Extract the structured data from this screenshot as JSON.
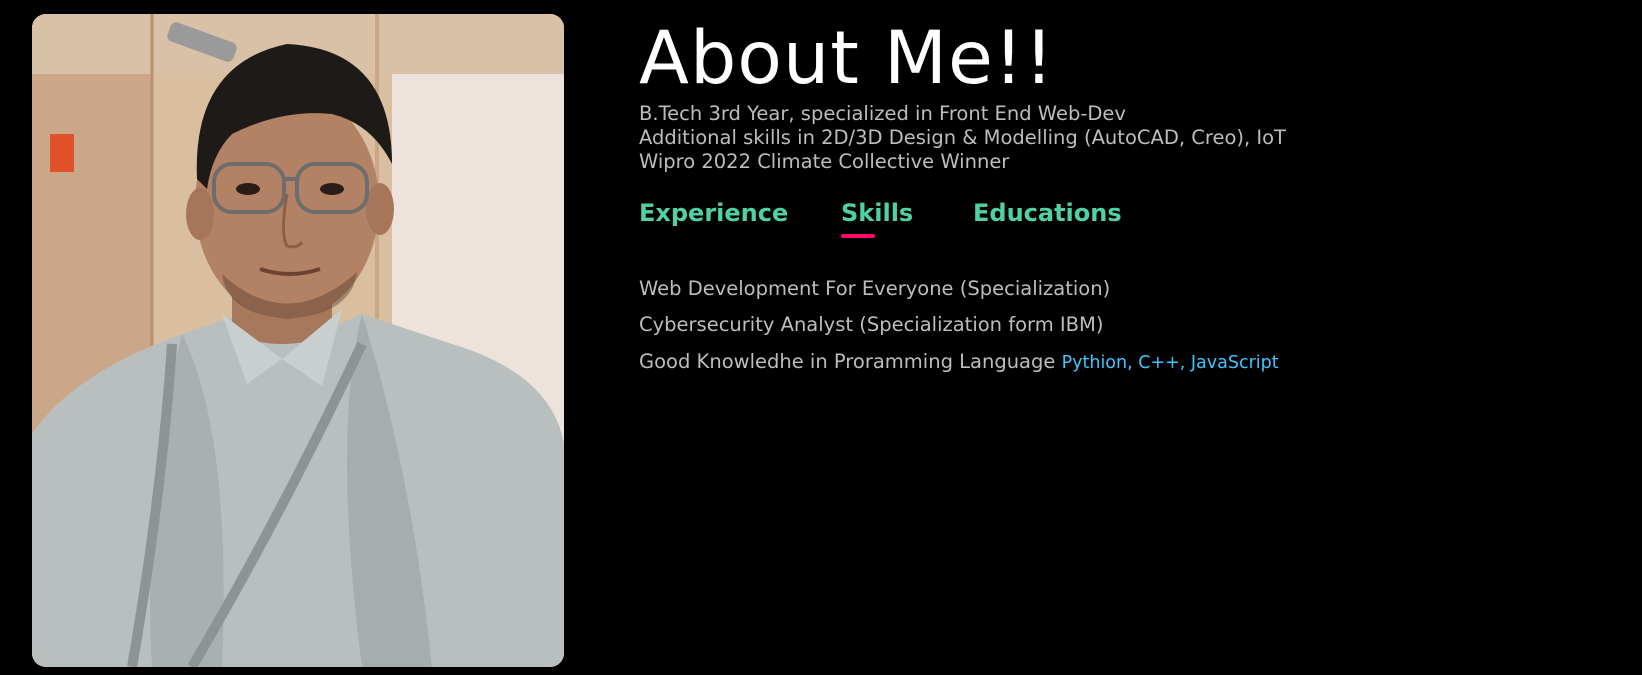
{
  "about": {
    "title": "About Me!!",
    "intro_lines": [
      "B.Tech 3rd Year, specialized in Front End Web-Dev",
      "Additional skills in 2D/3D Design & Modelling (AutoCAD, Creo), IoT",
      "Wipro 2022 Climate Collective Winner"
    ]
  },
  "tabs": [
    {
      "label": "Experience",
      "active": false
    },
    {
      "label": "Skills",
      "active": true
    },
    {
      "label": "Educations",
      "active": false
    }
  ],
  "skills": [
    {
      "text": "Web Development For Everyone (Specialization)",
      "highlight": ""
    },
    {
      "text": "Cybersecurity Analyst (Specialization form IBM)",
      "highlight": ""
    },
    {
      "text": "Good Knowledhe in Proramming Language ",
      "highlight": "Pythion, C++, JavaScript"
    }
  ],
  "colors": {
    "background": "#000000",
    "title": "#ffffff",
    "body_text": "#bdbdbd",
    "tab_text": "#4fd1a5",
    "tab_underline": "#ff0a6c",
    "highlight_text": "#3ec6ff"
  },
  "photo": {
    "subject": "profile-photo"
  }
}
